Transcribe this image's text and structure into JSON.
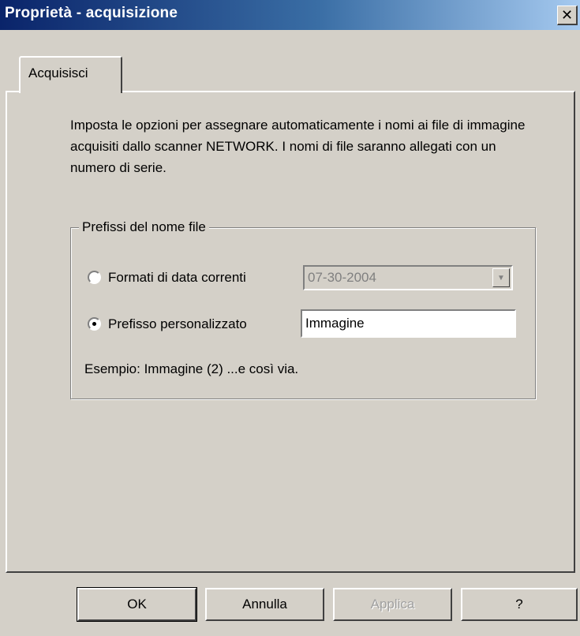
{
  "window": {
    "title": "Proprietà - acquisizione",
    "close_glyph": "✕"
  },
  "tabs": [
    {
      "label": "Acquisisci",
      "selected": true
    }
  ],
  "description": "Imposta le opzioni per assegnare automaticamente i nomi ai file di immagine acquisiti dallo scanner NETWORK. I nomi di file saranno allegati con un numero di serie.",
  "prefix_group": {
    "label": "Prefissi del nome file",
    "date_option": {
      "label": "Formati di data correnti",
      "selected": false,
      "combo_value": "07-30-2004",
      "enabled": false
    },
    "custom_option": {
      "label": "Prefisso personalizzato",
      "selected": true,
      "input_value": "Immagine"
    },
    "example": "Esempio: Immagine (2) ...e così via."
  },
  "buttons": {
    "ok": "OK",
    "cancel": "Annulla",
    "apply": "Applica",
    "help": "?"
  },
  "colors": {
    "face": "#d4d0c8",
    "title_start": "#0a246a",
    "title_end": "#a6caf0"
  }
}
